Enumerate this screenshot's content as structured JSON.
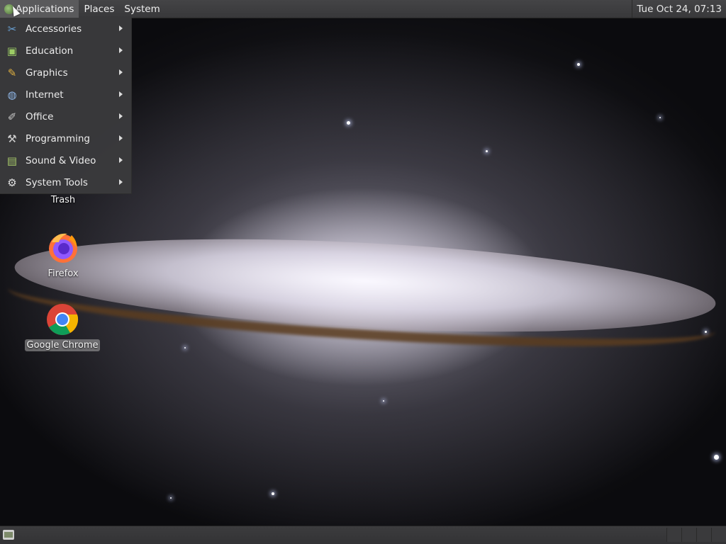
{
  "top_panel": {
    "menus": [
      {
        "label": "Applications",
        "active": true
      },
      {
        "label": "Places",
        "active": false
      },
      {
        "label": "System",
        "active": false
      }
    ],
    "clock": "Tue Oct 24, 07:13"
  },
  "applications_menu": {
    "items": [
      {
        "label": "Accessories",
        "icon": "accessories-icon"
      },
      {
        "label": "Education",
        "icon": "education-icon"
      },
      {
        "label": "Graphics",
        "icon": "graphics-icon"
      },
      {
        "label": "Internet",
        "icon": "internet-icon"
      },
      {
        "label": "Office",
        "icon": "office-icon"
      },
      {
        "label": "Programming",
        "icon": "programming-icon"
      },
      {
        "label": "Sound & Video",
        "icon": "sound-video-icon"
      },
      {
        "label": "System Tools",
        "icon": "system-tools-icon"
      }
    ]
  },
  "desktop": {
    "icons": [
      {
        "label": "Trash",
        "icon": "trash-icon",
        "selected": false
      },
      {
        "label": "Firefox",
        "icon": "firefox-icon",
        "selected": false
      },
      {
        "label": "Google Chrome",
        "icon": "chrome-icon",
        "selected": true
      }
    ]
  },
  "colors": {
    "panel": "#3c3c3e",
    "menu_bg": "#3a3a3c",
    "active_menu": "#5a5a5c"
  }
}
